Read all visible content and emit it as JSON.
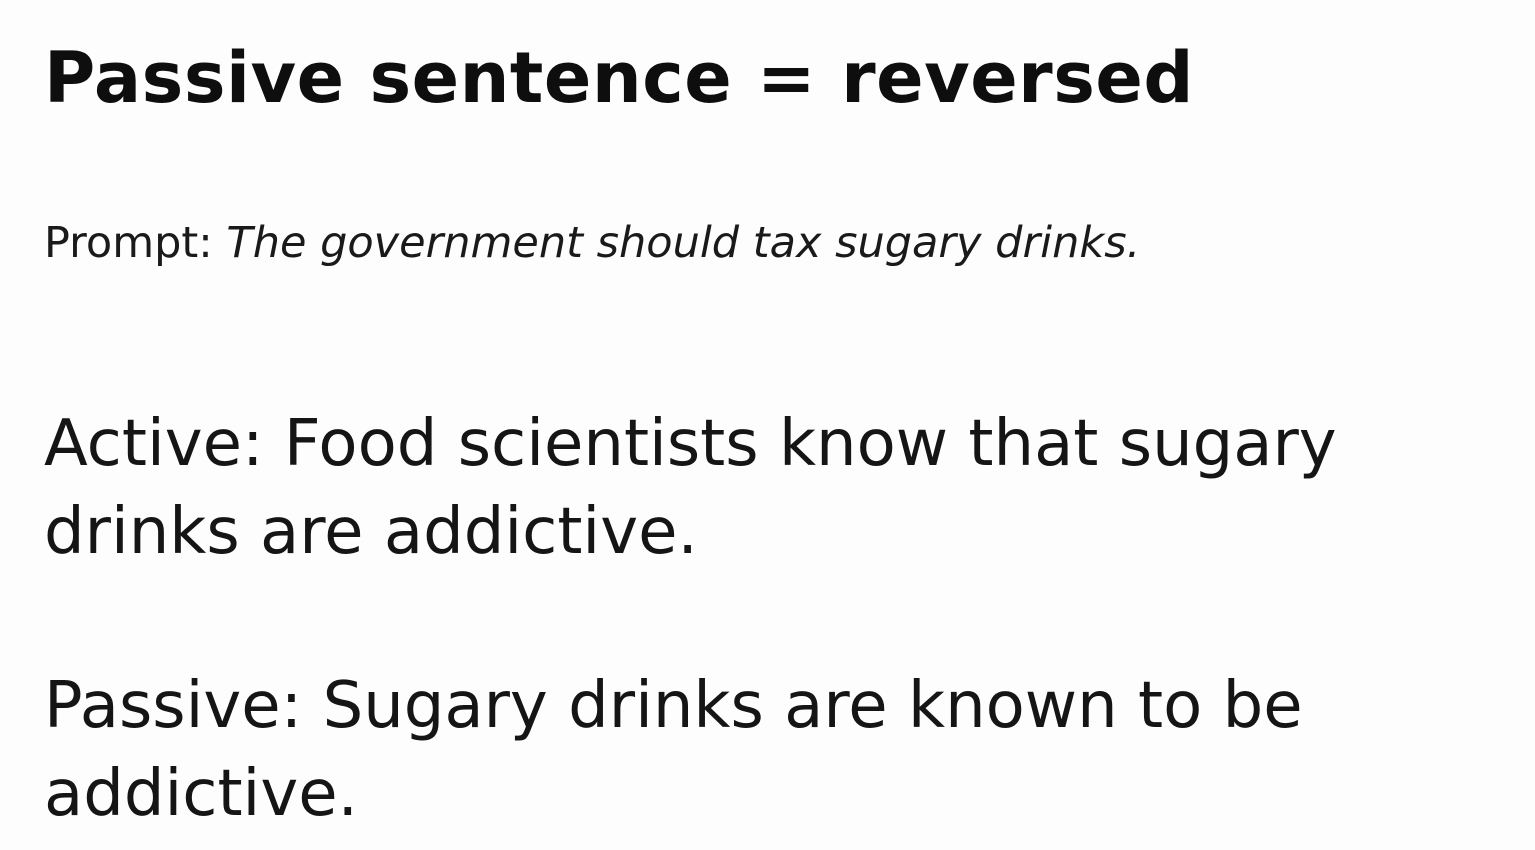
{
  "slide": {
    "title": "Passive sentence = reversed",
    "prompt": {
      "label": "Prompt:",
      "text": "The government should tax sugary drinks."
    },
    "examples": [
      {
        "label": "Active:",
        "text": "Food scientists know that sugary drinks are addictive."
      },
      {
        "label": "Passive:",
        "text": "Sugary drinks are known to be addictive."
      }
    ]
  }
}
